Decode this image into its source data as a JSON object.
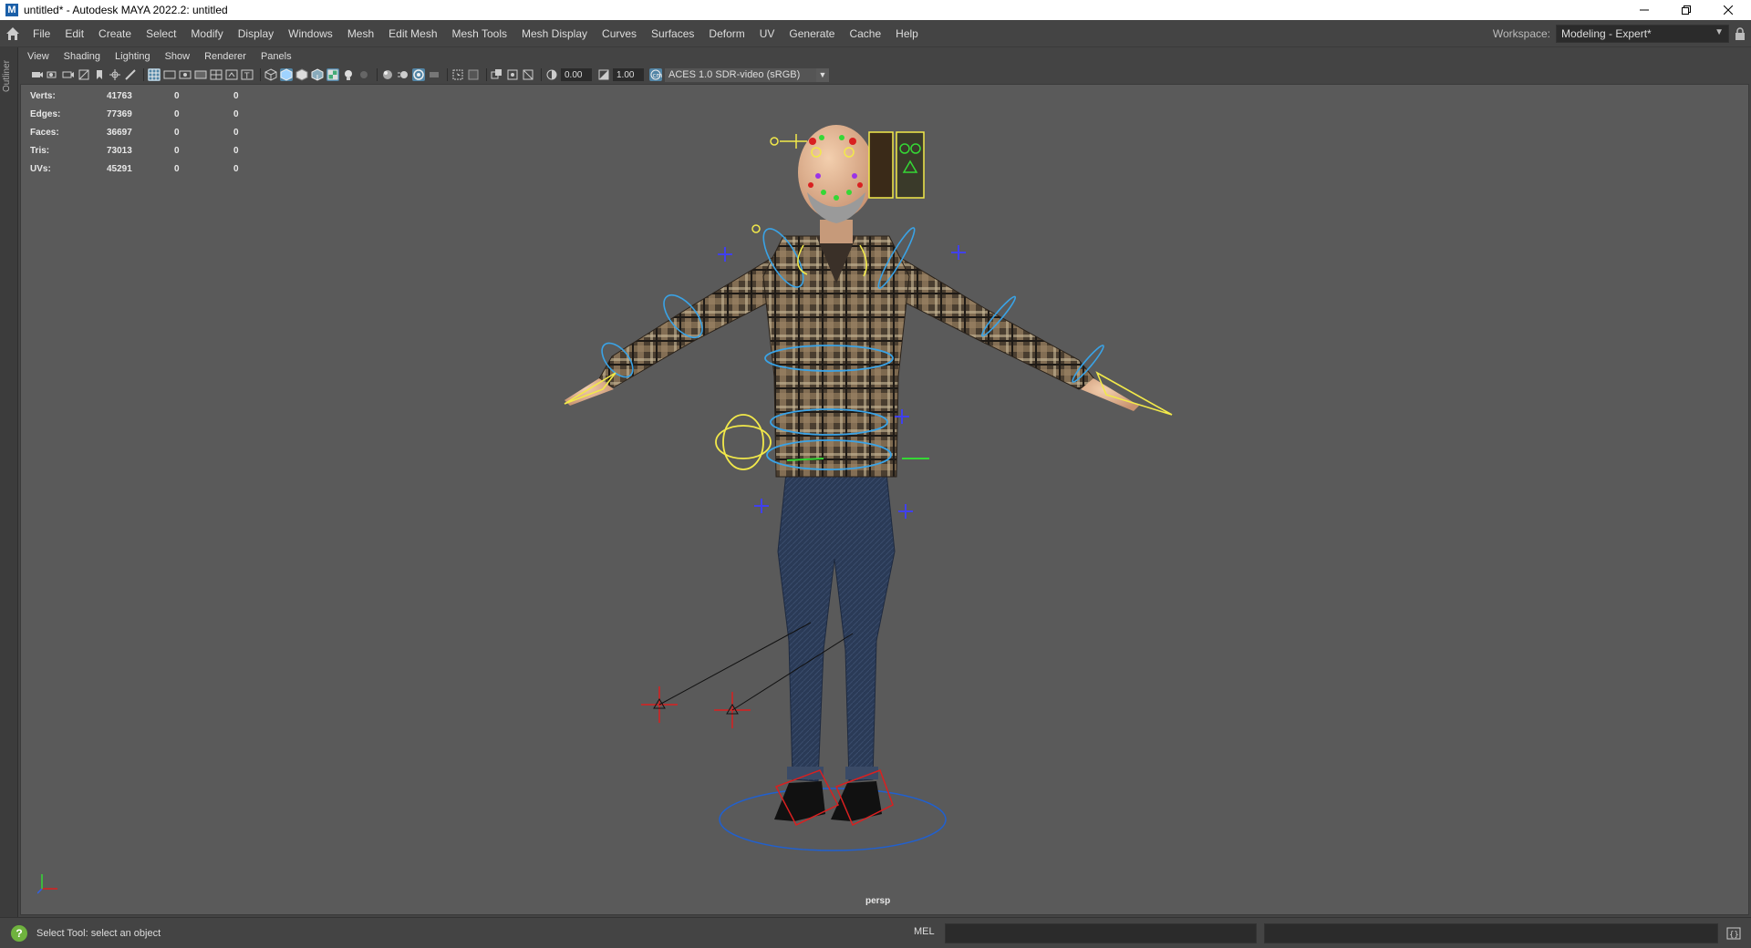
{
  "window": {
    "title": "untitled* - Autodesk MAYA 2022.2: untitled",
    "app_icon": "M"
  },
  "menubar": {
    "items": [
      "File",
      "Edit",
      "Create",
      "Select",
      "Modify",
      "Display",
      "Windows",
      "Mesh",
      "Edit Mesh",
      "Mesh Tools",
      "Mesh Display",
      "Curves",
      "Surfaces",
      "Deform",
      "UV",
      "Generate",
      "Cache",
      "Help"
    ],
    "workspace_label": "Workspace:",
    "workspace_value": "Modeling - Expert*"
  },
  "outliner": {
    "tab_label": "Outliner"
  },
  "panel_menu": {
    "items": [
      "View",
      "Shading",
      "Lighting",
      "Show",
      "Renderer",
      "Panels"
    ]
  },
  "panel_toolbar": {
    "exposure": "0.00",
    "gamma": "1.00",
    "color_space": "ACES 1.0 SDR-video (sRGB)"
  },
  "hud": {
    "rows": [
      {
        "label": "Verts:",
        "v1": "41763",
        "v2": "0",
        "v3": "0"
      },
      {
        "label": "Edges:",
        "v1": "77369",
        "v2": "0",
        "v3": "0"
      },
      {
        "label": "Faces:",
        "v1": "36697",
        "v2": "0",
        "v3": "0"
      },
      {
        "label": "Tris:",
        "v1": "73013",
        "v2": "0",
        "v3": "0"
      },
      {
        "label": "UVs:",
        "v1": "45291",
        "v2": "0",
        "v3": "0"
      }
    ]
  },
  "viewport": {
    "camera": "persp"
  },
  "statusbar": {
    "help_text": "Select Tool: select an object",
    "mel_label": "MEL"
  },
  "colors": {
    "background": "#444444",
    "viewport": "#5a5a5a",
    "accent": "#5285a6",
    "controls_yellow": "#f2e94a",
    "controls_blue": "#3aa3e6",
    "controls_red": "#d92020",
    "controls_green": "#35d835"
  }
}
